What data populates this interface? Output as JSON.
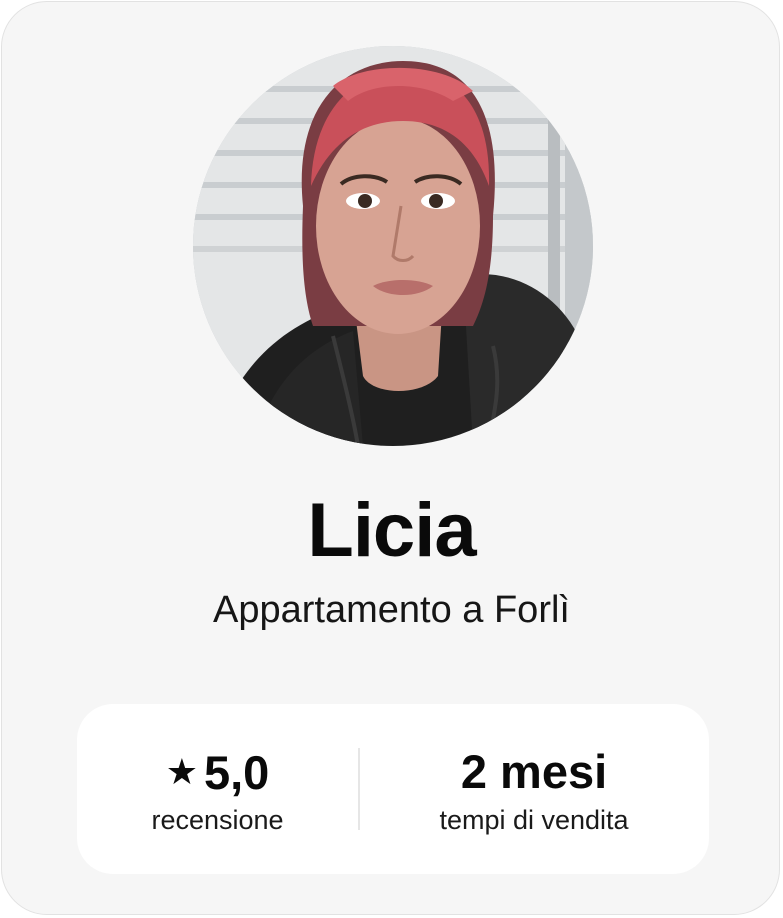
{
  "profile": {
    "name": "Licia",
    "subtitle": "Appartamento a Forlì",
    "avatar_icon": "person-photo"
  },
  "stats": {
    "rating": {
      "icon": "star-icon",
      "star_glyph": "★",
      "value": "5,0",
      "label": "recensione"
    },
    "sale_time": {
      "value": "2 mesi",
      "label": "tempi di vendita"
    }
  },
  "colors": {
    "card_background": "#f6f6f6",
    "stats_background": "#ffffff",
    "text_primary": "#0a0a0a",
    "hair_accent": "#c9505a"
  }
}
